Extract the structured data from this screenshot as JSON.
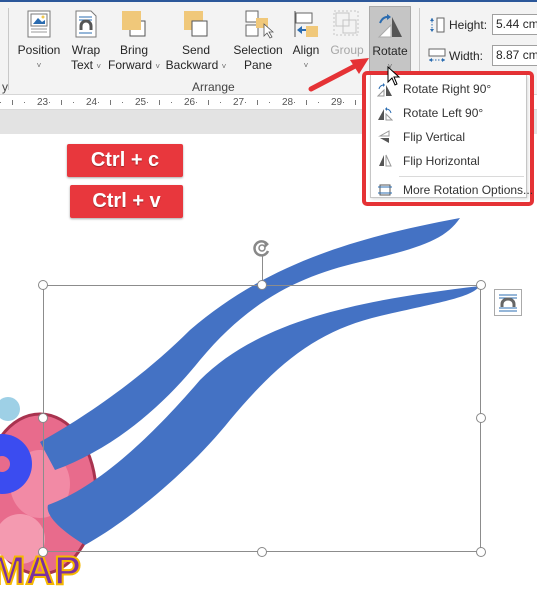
{
  "ribbon": {
    "buttons": [
      {
        "id": "position",
        "line1": "Position",
        "line2": "",
        "chevron": "˅"
      },
      {
        "id": "wrap-text",
        "line1": "Wrap",
        "line2": "Text",
        "chevron": "˅"
      },
      {
        "id": "bring-forward",
        "line1": "Bring",
        "line2": "Forward",
        "chevron": "˅"
      },
      {
        "id": "send-backward",
        "line1": "Send",
        "line2": "Backward",
        "chevron": "˅"
      },
      {
        "id": "selection-pane",
        "line1": "Selection",
        "line2": "Pane",
        "chevron": ""
      },
      {
        "id": "align",
        "line1": "Align",
        "line2": "",
        "chevron": "˅"
      },
      {
        "id": "group",
        "line1": "Group",
        "line2": "",
        "chevron": "",
        "disabled": true
      },
      {
        "id": "rotate",
        "line1": "Rotate",
        "line2": "",
        "chevron": "˅",
        "active": true
      }
    ],
    "group_label": "Arrange",
    "left_group_fragment": "y",
    "size": {
      "height_label": "Height:",
      "height_value": "5.44 cm",
      "width_label": "Width:",
      "width_value": "8.87 cm"
    }
  },
  "ruler": {
    "numbers": [
      "23",
      "24",
      "25",
      "26",
      "27",
      "28",
      "29"
    ]
  },
  "rotate_menu": {
    "items": [
      {
        "label": "Rotate Right 90°",
        "icon": "rotate-right-icon"
      },
      {
        "label": "Rotate Left 90°",
        "icon": "rotate-left-icon"
      },
      {
        "label": "Flip Vertical",
        "icon": "flip-vertical-icon"
      },
      {
        "label": "Flip Horizontal",
        "icon": "flip-horizontal-icon"
      },
      {
        "label": "More Rotation Options...",
        "icon": "more-rotation-options-icon"
      }
    ]
  },
  "annotations": {
    "copy_shortcut": "Ctrl + c",
    "paste_shortcut": "Ctrl + v"
  },
  "canvas": {
    "shape_color": "#4472c4",
    "clipart_text": "MAP",
    "highlight_color": "#e53235"
  }
}
